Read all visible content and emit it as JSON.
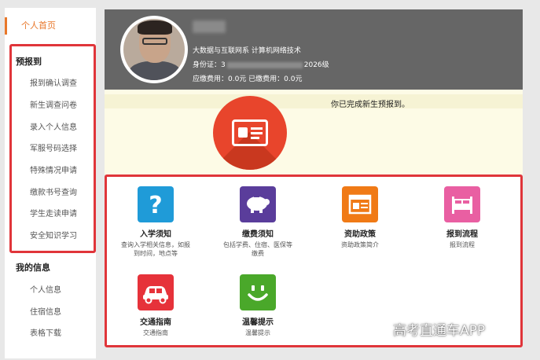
{
  "sidebar": {
    "home_label": "个人首页",
    "pre_register": {
      "title": "预报到",
      "items": [
        "报到确认调查",
        "新生调查问卷",
        "录入个人信息",
        "军服号码选择",
        "特殊情况申请",
        "缴款书号查询",
        "学生走读申请",
        "安全知识学习"
      ]
    },
    "my_info": {
      "title": "我的信息",
      "items": [
        "个人信息",
        "住宿信息",
        "表格下载"
      ]
    }
  },
  "profile": {
    "department": "大数据与互联网系  计算机网络技术",
    "id_label": "身份证：",
    "id_visible_prefix": "3",
    "grade": "2026级",
    "fees_line": "应缴费用：0.0元   已缴费用：0.0元"
  },
  "banner": {
    "message": "你已完成新生预报到。"
  },
  "tiles": [
    {
      "title": "入学须知",
      "desc": "查询入学相关信息，如报到时间，地点等",
      "icon": "question-icon",
      "color": "#1f9bd8"
    },
    {
      "title": "缴费须知",
      "desc": "包括学费、住宿、医保等缴费",
      "icon": "piggy-bank-icon",
      "color": "#5a3d9b"
    },
    {
      "title": "资助政策",
      "desc": "资助政策简介",
      "icon": "document-icon",
      "color": "#f07a16"
    },
    {
      "title": "报到流程",
      "desc": "报到流程",
      "icon": "bed-icon",
      "color": "#e95fa2"
    },
    {
      "title": "交通指南",
      "desc": "交通指南",
      "icon": "car-icon",
      "color": "#e6323a"
    },
    {
      "title": "温馨提示",
      "desc": "温馨提示",
      "icon": "smiley-icon",
      "color": "#4aa82a"
    }
  ],
  "watermark": "高考直通车APP"
}
